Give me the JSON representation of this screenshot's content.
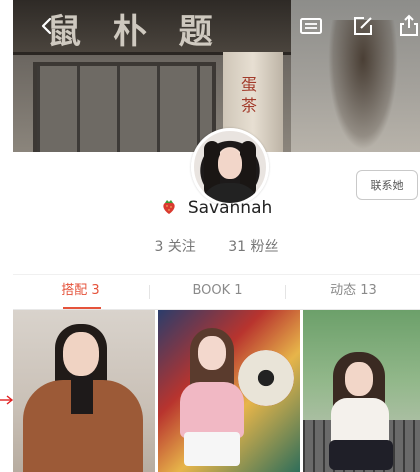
{
  "topbar": {
    "back_icon": "chevron-left-icon",
    "card_icon": "id-card-icon",
    "edit_icon": "edit-icon",
    "share_icon": "share-icon"
  },
  "cover": {
    "sign_text": "鼠 朴 题",
    "pillar_text": "蛋 茶"
  },
  "profile": {
    "username": "Savannah",
    "badge_icon": "strawberry-icon",
    "contact_label": "联系她",
    "following_label": "3 关注",
    "followers_label": "31 粉丝"
  },
  "tabs": [
    {
      "label": "搭配 3",
      "active": true
    },
    {
      "label": "BOOK 1",
      "active": false
    },
    {
      "label": "动态 13",
      "active": false
    }
  ],
  "colors": {
    "accent": "#e5533b",
    "arrow": "#e02020"
  }
}
